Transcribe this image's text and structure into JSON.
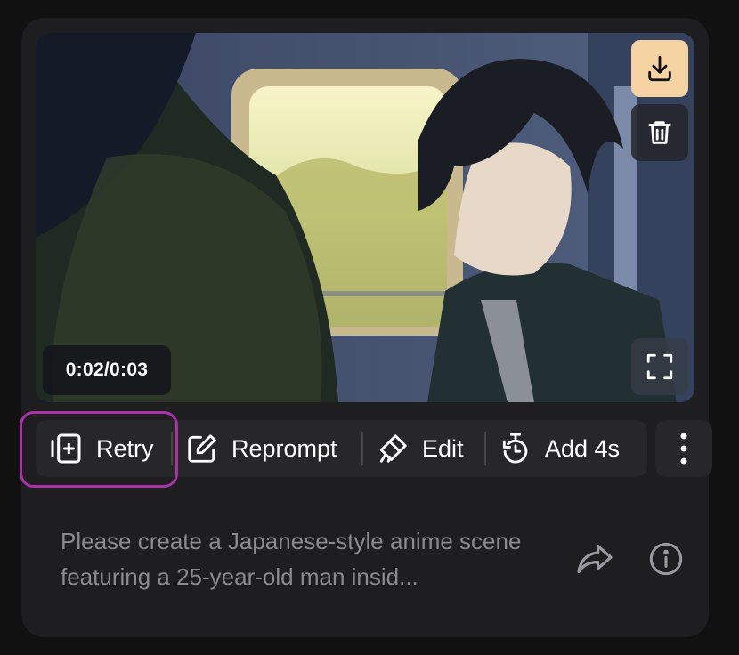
{
  "video": {
    "timecode": "0:02/0:03",
    "download_icon": "download-icon",
    "delete_icon": "trash-icon",
    "fullscreen_icon": "fullscreen-icon"
  },
  "toolbar": {
    "retry_label": "Retry",
    "reprompt_label": "Reprompt",
    "edit_label": "Edit",
    "add_label": "Add 4s",
    "more_icon": "more-vertical-icon"
  },
  "prompt": {
    "text": "Please create a Japanese-style anime scene featuring a 25-year-old man insid..."
  },
  "colors": {
    "accent_download": "#f6d3a3",
    "highlight_ring": "#a833a8",
    "card_bg": "#1e1e20",
    "toolbar_bg": "#27272a"
  }
}
